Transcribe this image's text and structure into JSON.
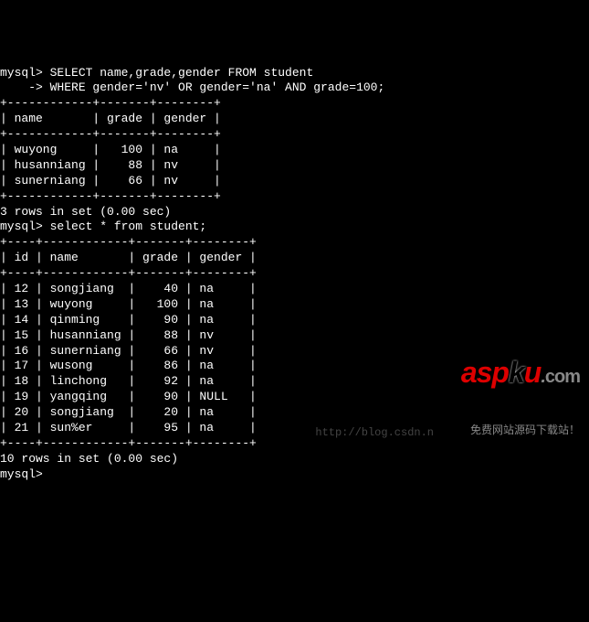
{
  "query1": {
    "prompt": "mysql>",
    "cont_prompt": "    ->",
    "line1": "SELECT name,grade,gender FROM student",
    "line2": "WHERE gender='nv' OR gender='na' AND grade=100;",
    "headers": {
      "name": "name",
      "grade": "grade",
      "gender": "gender"
    },
    "rows": [
      {
        "name": "wuyong",
        "grade": "100",
        "gender": "na"
      },
      {
        "name": "husanniang",
        "grade": "88",
        "gender": "nv"
      },
      {
        "name": "sunerniang",
        "grade": "66",
        "gender": "nv"
      }
    ],
    "status": "3 rows in set (0.00 sec)"
  },
  "query2": {
    "prompt": "mysql>",
    "sql": "select * from student;",
    "headers": {
      "id": "id",
      "name": "name",
      "grade": "grade",
      "gender": "gender"
    },
    "rows": [
      {
        "id": "12",
        "name": "songjiang",
        "grade": "40",
        "gender": "na"
      },
      {
        "id": "13",
        "name": "wuyong",
        "grade": "100",
        "gender": "na"
      },
      {
        "id": "14",
        "name": "qinming",
        "grade": "90",
        "gender": "na"
      },
      {
        "id": "15",
        "name": "husanniang",
        "grade": "88",
        "gender": "nv"
      },
      {
        "id": "16",
        "name": "sunerniang",
        "grade": "66",
        "gender": "nv"
      },
      {
        "id": "17",
        "name": "wusong",
        "grade": "86",
        "gender": "na"
      },
      {
        "id": "18",
        "name": "linchong",
        "grade": "92",
        "gender": "na"
      },
      {
        "id": "19",
        "name": "yangqing",
        "grade": "90",
        "gender": "NULL"
      },
      {
        "id": "20",
        "name": "songjiang",
        "grade": "20",
        "gender": "na"
      },
      {
        "id": "21",
        "name": "sun%er",
        "grade": "95",
        "gender": "na"
      }
    ],
    "status": "10 rows in set (0.00 sec)"
  },
  "final_prompt": "mysql>",
  "watermark": {
    "blogurl": "http://blog.csdn.n",
    "sub": "免费网站源码下载站！"
  }
}
